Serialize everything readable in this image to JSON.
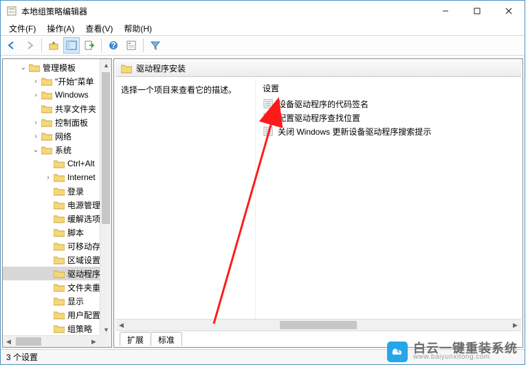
{
  "window": {
    "title": "本地组策略编辑器"
  },
  "menu": {
    "file": "文件(F)",
    "action": "操作(A)",
    "view": "查看(V)",
    "help": "帮助(H)"
  },
  "toolbar_icons": [
    "back",
    "forward",
    "up",
    "tiles",
    "export",
    "help",
    "props",
    "filter"
  ],
  "tree": {
    "root_label": "管理模板",
    "items": [
      {
        "indent": 1,
        "twisty": ">",
        "label": "\"开始\"菜单"
      },
      {
        "indent": 1,
        "twisty": ">",
        "label": "Windows"
      },
      {
        "indent": 1,
        "twisty": "",
        "label": "共享文件夹"
      },
      {
        "indent": 1,
        "twisty": ">",
        "label": "控制面板"
      },
      {
        "indent": 1,
        "twisty": ">",
        "label": "网络"
      },
      {
        "indent": 1,
        "twisty": "v",
        "label": "系统"
      },
      {
        "indent": 2,
        "twisty": "",
        "label": "Ctrl+Alt"
      },
      {
        "indent": 2,
        "twisty": ">",
        "label": "Internet"
      },
      {
        "indent": 2,
        "twisty": "",
        "label": "登录"
      },
      {
        "indent": 2,
        "twisty": "",
        "label": "电源管理"
      },
      {
        "indent": 2,
        "twisty": "",
        "label": "缓解选项"
      },
      {
        "indent": 2,
        "twisty": "",
        "label": "脚本"
      },
      {
        "indent": 2,
        "twisty": "",
        "label": "可移动存"
      },
      {
        "indent": 2,
        "twisty": "",
        "label": "区域设置"
      },
      {
        "indent": 2,
        "twisty": "",
        "label": "驱动程序",
        "selected": true
      },
      {
        "indent": 2,
        "twisty": "",
        "label": "文件夹重"
      },
      {
        "indent": 2,
        "twisty": "",
        "label": "显示"
      },
      {
        "indent": 2,
        "twisty": "",
        "label": "用户配置"
      },
      {
        "indent": 2,
        "twisty": "",
        "label": "组策略"
      }
    ]
  },
  "right": {
    "header": "驱动程序安装",
    "desc": "选择一个项目来查看它的描述。",
    "settings_label": "设置",
    "settings": [
      "设备驱动程序的代码签名",
      "配置驱动程序查找位置",
      "关闭 Windows 更新设备驱动程序搜索提示"
    ],
    "tabs": {
      "extended": "扩展",
      "standard": "标准"
    }
  },
  "status": {
    "text": "3 个设置"
  },
  "watermark": {
    "cn": "白云一键重装系统",
    "en": "www.baiyunxitong.com"
  }
}
